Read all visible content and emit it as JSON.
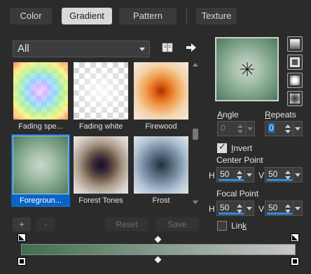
{
  "tabs": [
    {
      "label": "Color",
      "active": false
    },
    {
      "label": "Gradient",
      "active": true
    },
    {
      "label": "Pattern",
      "active": false
    },
    {
      "label": "Texture",
      "active": false
    }
  ],
  "category_dropdown": {
    "value": "All"
  },
  "gallery": [
    {
      "name": "Fading spe...",
      "selected": false
    },
    {
      "name": "Fading white",
      "selected": false
    },
    {
      "name": "Firewood",
      "selected": false
    },
    {
      "name": "Foregroun...",
      "selected": true
    },
    {
      "name": "Forest Tones",
      "selected": false
    },
    {
      "name": "Frost",
      "selected": false
    }
  ],
  "angle": {
    "label": "Angle",
    "value": "0",
    "enabled": false
  },
  "repeats": {
    "label": "Repeats",
    "value": "0"
  },
  "invert": {
    "label": "Invert",
    "checked": true
  },
  "center_point": {
    "label": "Center Point",
    "h_label": "H",
    "h_value": "50",
    "v_label": "V",
    "v_value": "50"
  },
  "focal_point": {
    "label": "Focal Point",
    "h_label": "H",
    "h_value": "50",
    "v_label": "V",
    "v_value": "50"
  },
  "link": {
    "label": "Link",
    "checked": false
  },
  "buttons": {
    "add": "+",
    "remove": "-",
    "reset": "Reset",
    "save": "Save"
  },
  "icons": {
    "library": "book-icon",
    "export": "arrow-right-icon",
    "shapes": [
      "linear-shape-icon",
      "rectangular-shape-icon",
      "sunburst-shape-icon",
      "radial-shape-icon"
    ]
  },
  "colors": {
    "gradient_start": "#3f6f4e",
    "gradient_end": "#c8c8c8",
    "accent": "#1f6fbf",
    "background": "#2b2b2b"
  }
}
